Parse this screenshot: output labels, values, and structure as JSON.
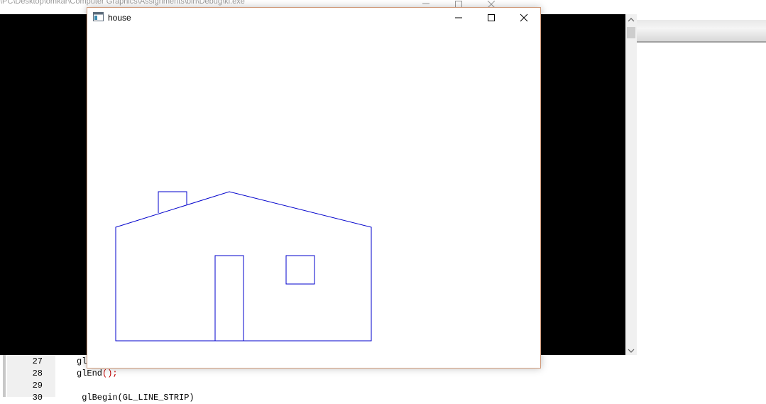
{
  "console": {
    "title": "\\PC\\Desktop\\omkar\\Computer Graphics\\Assignments\\bin\\Debug\\kl.exe\""
  },
  "gl_window": {
    "title": "house",
    "stroke_color": "#0000cc"
  },
  "editor": {
    "lines": [
      {
        "number": "27",
        "text": "gl"
      },
      {
        "number": "28",
        "text": "glEnd",
        "punct": "();"
      },
      {
        "number": "29",
        "text": ""
      },
      {
        "number": "30",
        "text": " glBegin(GL_LINE_STRIP)"
      }
    ]
  },
  "icons": {
    "minimize": "minimize-icon",
    "maximize": "maximize-icon",
    "close": "close-icon",
    "app": "opengl-window-icon"
  }
}
